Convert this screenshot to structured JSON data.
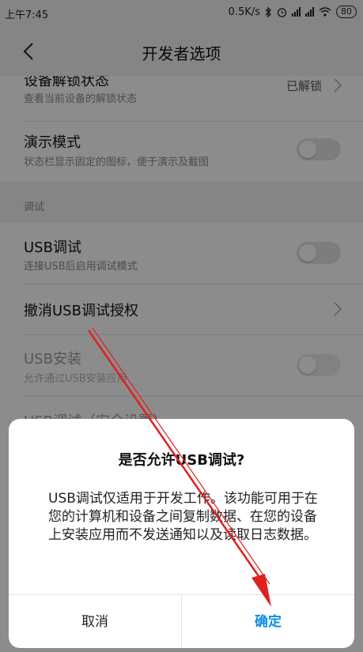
{
  "status_bar": {
    "time": "上午7:45",
    "speed": "0.5K/s",
    "battery": "80"
  },
  "app_bar": {
    "title": "开发者选项"
  },
  "rows": [
    {
      "title": "设备解锁状态",
      "subtitle": "查看当前设备的解锁状态",
      "value": "已解锁"
    },
    {
      "title": "演示模式",
      "subtitle": "状态栏显示固定的图标，便于演示及截图"
    }
  ],
  "debug_section": {
    "header": "调试",
    "rows": [
      {
        "title": "USB调试",
        "subtitle": "连接USB后启用调试模式"
      },
      {
        "title": "撤消USB调试授权"
      },
      {
        "title": "USB安装",
        "subtitle": "允许通过USB安装应用"
      },
      {
        "title": "USB调试（安全设置）"
      }
    ]
  },
  "dialog": {
    "title": "是否允许USB调试?",
    "message": "USB调试仅适用于开发工作。该功能可用于在您的计算机和设备之间复制数据、在您的设备上安装应用而不发送通知以及读取日志数据。",
    "cancel_label": "取消",
    "ok_label": "确定"
  },
  "colors": {
    "accent": "#0a8ee0",
    "annotation_arrow": "#e02020"
  }
}
